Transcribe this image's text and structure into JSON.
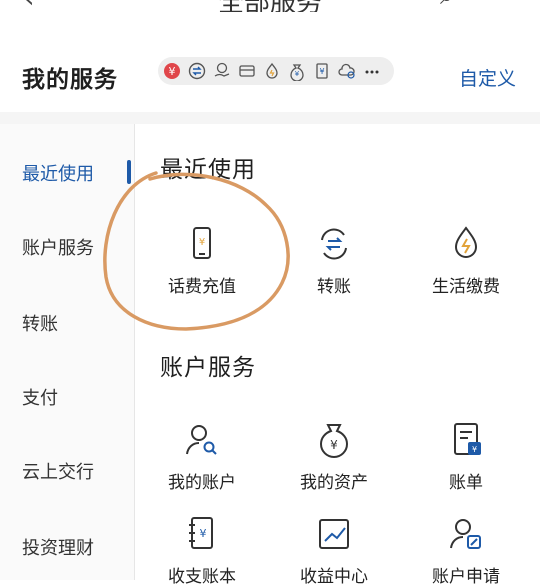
{
  "header": {
    "title": "全部服务",
    "back_icon": "back-arrow-icon",
    "search_icon": "search-icon",
    "more_icon": "more-icon"
  },
  "my_services": {
    "title": "我的服务",
    "custom_label": "自定义",
    "icons": [
      "rmb-coin-icon",
      "transfer-circle-icon",
      "hand-money-icon",
      "card-icon",
      "drop-icon",
      "money-bag-icon",
      "bill-yen-icon",
      "cloud-yen-icon",
      "more-dots-icon"
    ],
    "accent": "#1e5aa8"
  },
  "sidebar": {
    "items": [
      {
        "label": "最近使用",
        "active": true
      },
      {
        "label": "账户服务",
        "active": false
      },
      {
        "label": "转账",
        "active": false
      },
      {
        "label": "支付",
        "active": false
      },
      {
        "label": "云上交行",
        "active": false
      },
      {
        "label": "投资理财",
        "active": false
      }
    ]
  },
  "sections": [
    {
      "title": "最近使用",
      "items": [
        {
          "label": "话费充值",
          "icon": "phone-topup-icon"
        },
        {
          "label": "转账",
          "icon": "transfer-icon"
        },
        {
          "label": "生活缴费",
          "icon": "utility-payment-icon"
        }
      ]
    },
    {
      "title": "账户服务",
      "items": [
        {
          "label": "我的账户",
          "icon": "my-account-icon"
        },
        {
          "label": "我的资产",
          "icon": "my-assets-icon"
        },
        {
          "label": "账单",
          "icon": "bill-icon"
        },
        {
          "label": "收支账本",
          "icon": "ledger-icon"
        },
        {
          "label": "收益中心",
          "icon": "earnings-chart-icon"
        },
        {
          "label": "账户申请",
          "icon": "account-apply-icon"
        }
      ]
    }
  ],
  "annotation": {
    "color": "#d99a63"
  }
}
